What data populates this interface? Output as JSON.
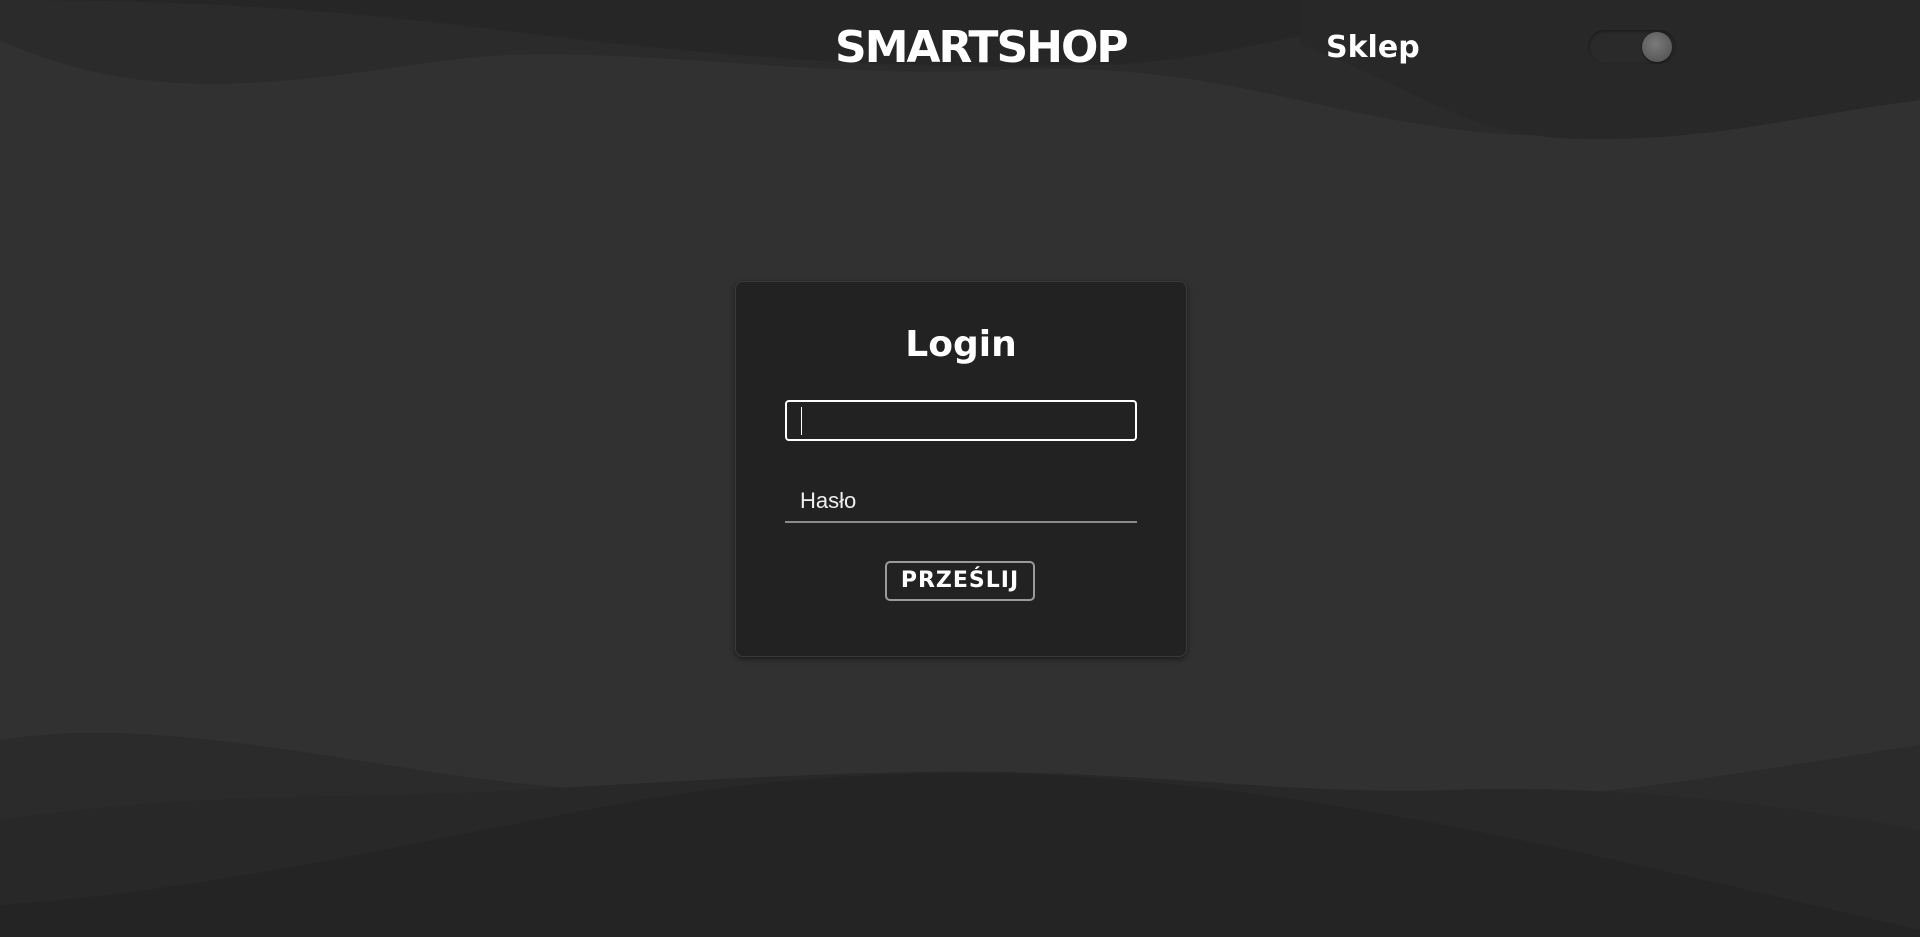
{
  "header": {
    "brand": "SMARTSHOP",
    "nav_shop": "Sklep",
    "theme_toggle_state": "on"
  },
  "login_form": {
    "title": "Login",
    "login_value": "",
    "password_placeholder": "Hasło",
    "submit_label": "PRZEŚLIJ"
  },
  "colors": {
    "background": "#313131",
    "wave_dark": "#242424",
    "card": "#222222",
    "text": "#ffffff"
  }
}
